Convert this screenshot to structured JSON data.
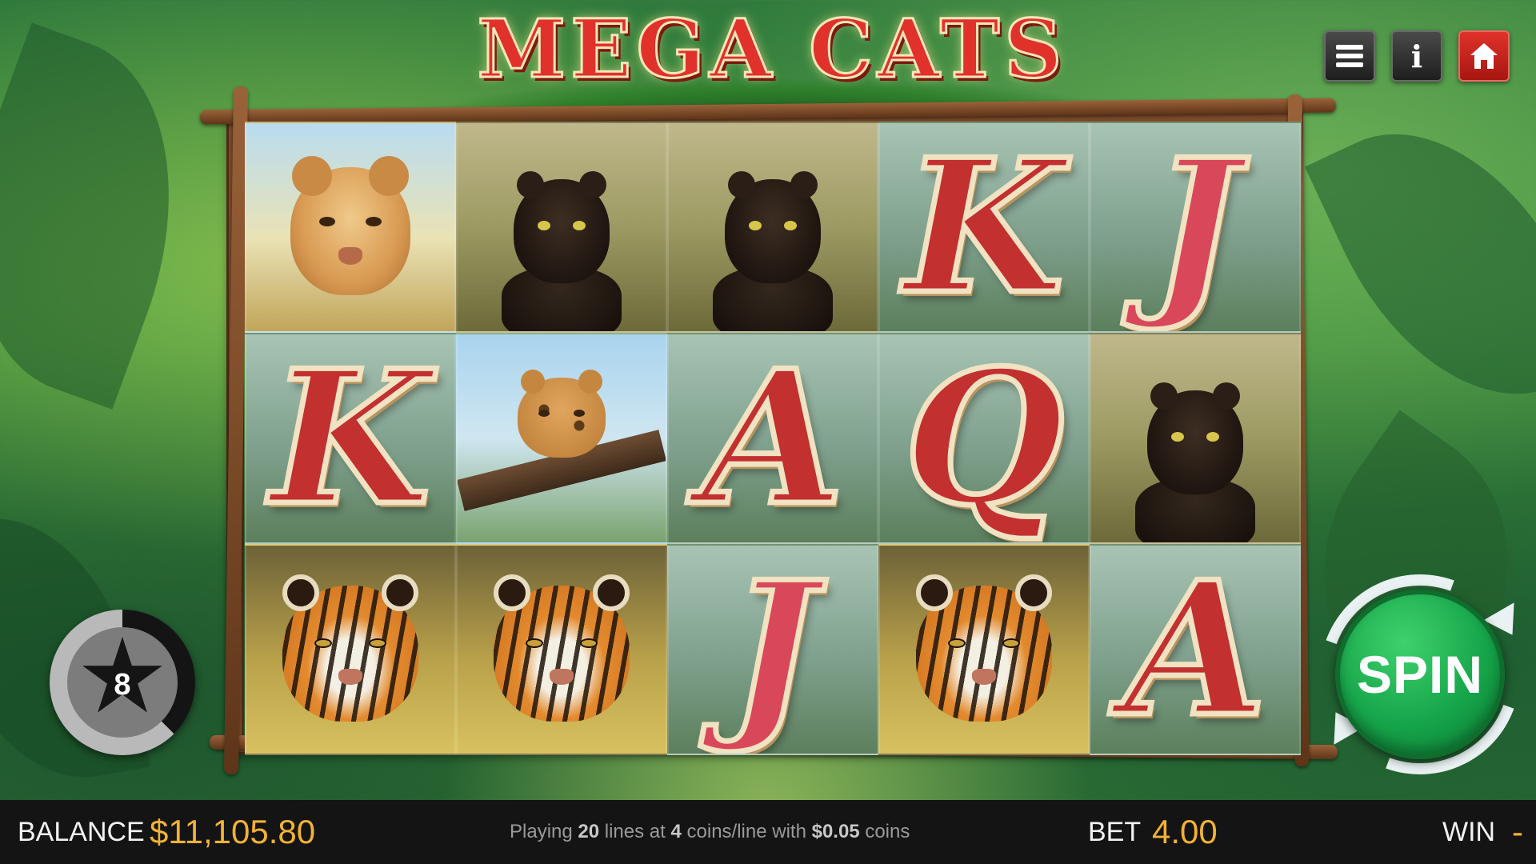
{
  "title": "MEGA CATS",
  "top_buttons": {
    "menu_icon": "hamburger-menu-icon",
    "info_label": "i",
    "home_icon": "home-icon"
  },
  "reels": [
    [
      {
        "symbol": "lioness",
        "label": ""
      },
      {
        "symbol": "K",
        "label": "K"
      },
      {
        "symbol": "tiger",
        "label": ""
      }
    ],
    [
      {
        "symbol": "black-panther",
        "label": ""
      },
      {
        "symbol": "leopard",
        "label": ""
      },
      {
        "symbol": "tiger",
        "label": ""
      }
    ],
    [
      {
        "symbol": "black-panther",
        "label": ""
      },
      {
        "symbol": "A",
        "label": "A"
      },
      {
        "symbol": "J",
        "label": "J"
      }
    ],
    [
      {
        "symbol": "K",
        "label": "K"
      },
      {
        "symbol": "Q",
        "label": "Q"
      },
      {
        "symbol": "tiger",
        "label": ""
      }
    ],
    [
      {
        "symbol": "J",
        "label": "J"
      },
      {
        "symbol": "black-panther",
        "label": ""
      },
      {
        "symbol": "A",
        "label": "A"
      }
    ]
  ],
  "autoplay": {
    "count": "8",
    "icon": "star-icon"
  },
  "spin": {
    "label": "SPIN"
  },
  "bottom_bar": {
    "balance_label": "BALANCE",
    "balance_value": "$11,105.80",
    "info_prefix": "Playing",
    "lines": "20",
    "info_mid1": "lines at",
    "coins_per_line": "4",
    "info_mid2": "coins/line with",
    "coin_value": "$0.05",
    "info_suffix": "coins",
    "bet_label": "BET",
    "bet_value": "4.00",
    "win_label": "WIN",
    "win_value": "-"
  },
  "colors": {
    "accent_gold": "#f2b233",
    "spin_green": "#16a54a",
    "home_red": "#e0322b",
    "title_red": "#e0312b"
  }
}
